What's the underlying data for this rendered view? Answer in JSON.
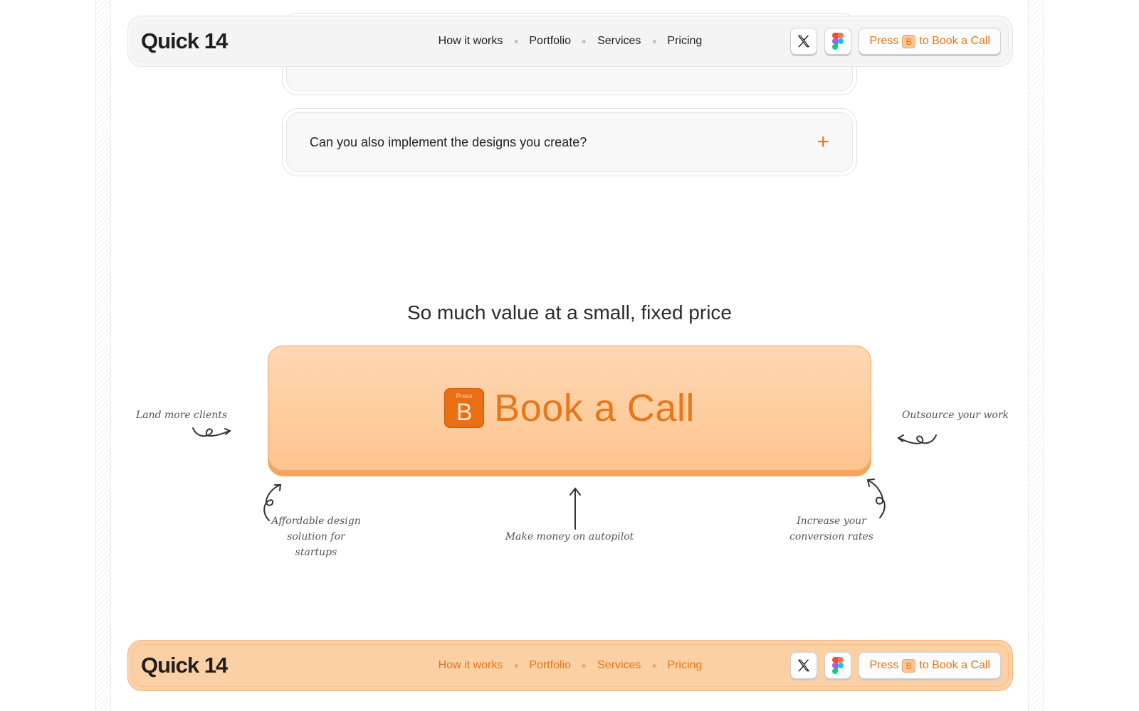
{
  "faq": {
    "items": [
      {
        "question": "",
        "state": "collapsed"
      },
      {
        "question": "Can you also implement the designs you create?",
        "state": "collapsed"
      }
    ],
    "expand_symbol": "+"
  },
  "nav_top": {
    "logo": "Quick 14",
    "links": [
      "How it works",
      "Portfolio",
      "Services",
      "Pricing"
    ],
    "icons": [
      "x-twitter-icon",
      "figma-icon"
    ],
    "cta": {
      "prefix": "Press",
      "key": "B",
      "suffix": "to Book a Call"
    }
  },
  "nav_bottom": {
    "logo": "Quick 14",
    "links": [
      "How it works",
      "Portfolio",
      "Services",
      "Pricing"
    ],
    "icons": [
      "x-twitter-icon",
      "figma-icon"
    ],
    "cta": {
      "prefix": "Press",
      "key": "B",
      "suffix": "to Book a Call"
    }
  },
  "pricing_section": {
    "headline": "So much value at a small, fixed price",
    "big_cta": {
      "key_caption": "Press",
      "key": "B",
      "label": "Book a Call"
    },
    "annotations": {
      "left": "Land more clients",
      "right": "Outsource your work",
      "bottom_left": "Affordable design solution for startups",
      "bottom_center": "Make money on autopilot",
      "bottom_right": "Increase your conversion rates"
    }
  },
  "colors": {
    "accent": "#e8771d",
    "cta_bg": "#ffc894",
    "key_bg": "#ea6f13"
  }
}
